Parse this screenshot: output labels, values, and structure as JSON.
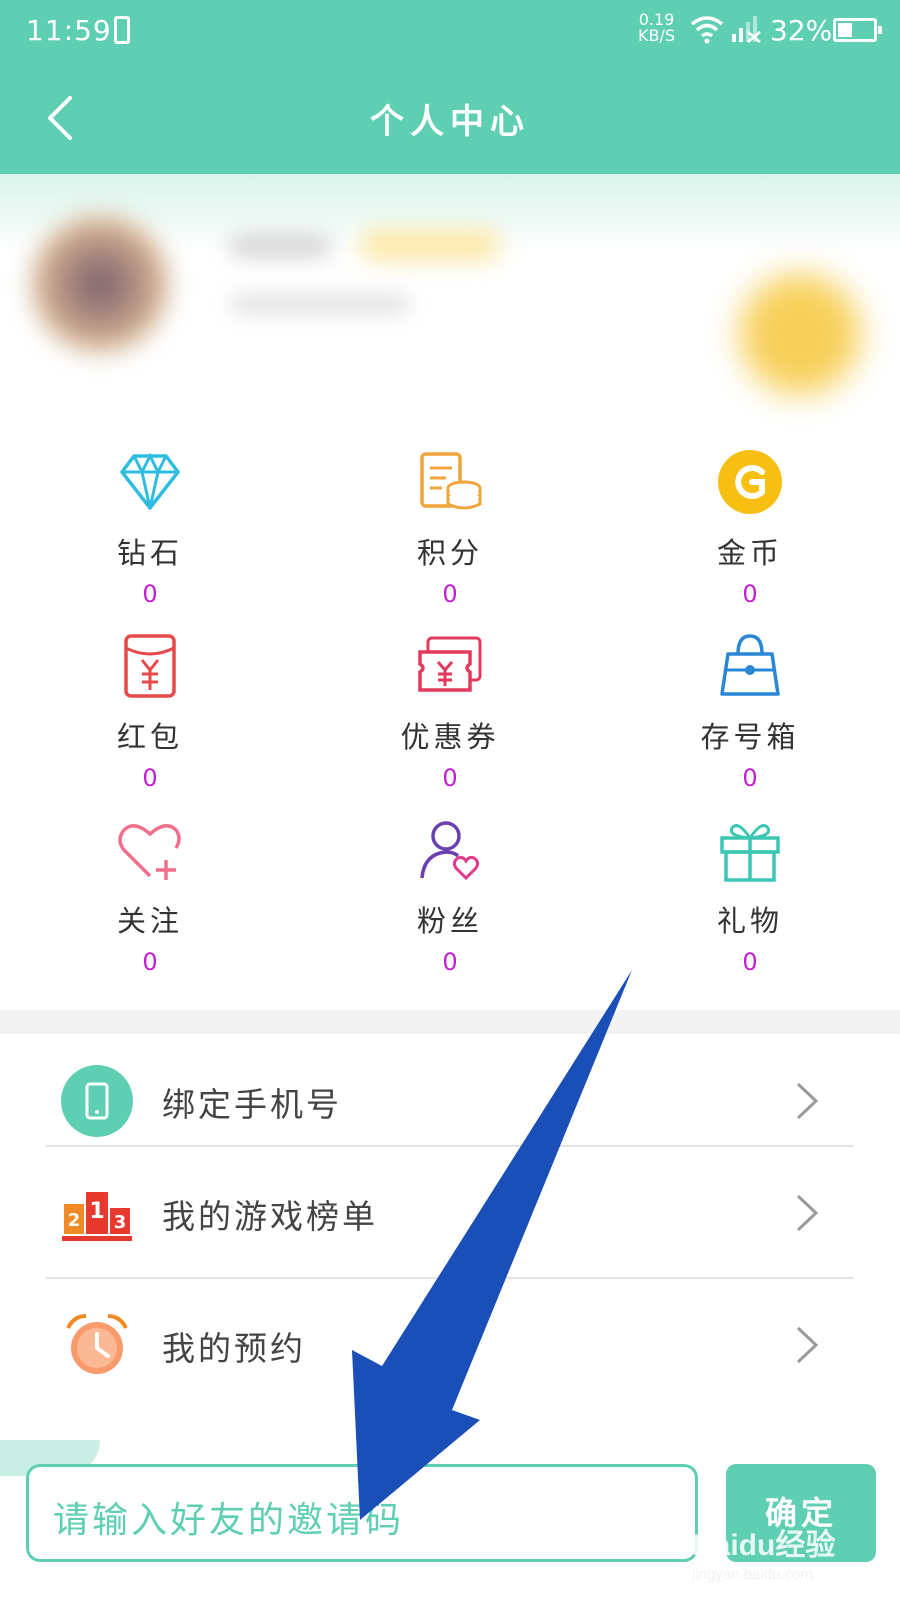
{
  "status_bar": {
    "time": "11:59",
    "net_speed_value": "0.19",
    "net_speed_unit": "KB/S",
    "battery": "32%"
  },
  "header": {
    "title": "个人中心"
  },
  "stats": [
    {
      "label": "钻石",
      "value": "0",
      "icon": "diamond-icon"
    },
    {
      "label": "积分",
      "value": "0",
      "icon": "coin-stack-icon"
    },
    {
      "label": "金币",
      "value": "0",
      "icon": "gold-coin-icon"
    },
    {
      "label": "红包",
      "value": "0",
      "icon": "red-packet-icon"
    },
    {
      "label": "优惠券",
      "value": "0",
      "icon": "coupon-icon"
    },
    {
      "label": "存号箱",
      "value": "0",
      "icon": "bag-icon"
    },
    {
      "label": "关注",
      "value": "0",
      "icon": "heart-plus-icon"
    },
    {
      "label": "粉丝",
      "value": "0",
      "icon": "fan-user-icon"
    },
    {
      "label": "礼物",
      "value": "0",
      "icon": "gift-icon"
    }
  ],
  "menu": [
    {
      "label": "绑定手机号",
      "icon": "phone-icon"
    },
    {
      "label": "我的游戏榜单",
      "icon": "podium-icon"
    },
    {
      "label": "我的预约",
      "icon": "alarm-clock-icon"
    }
  ],
  "invite": {
    "placeholder": "请输入好友的邀请码",
    "confirm_label": "确定"
  },
  "watermark": {
    "main": "Baidu经验",
    "url": "jingyan.baidu.com"
  },
  "colors": {
    "accent": "#5fcfb3",
    "value": "#c21ed1",
    "arrow": "#1a4fb8"
  }
}
